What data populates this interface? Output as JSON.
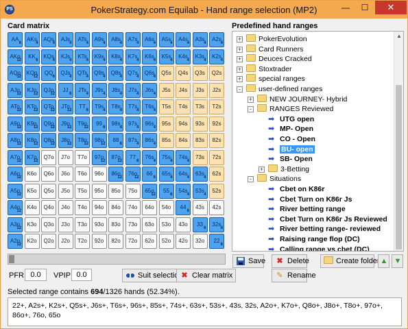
{
  "window": {
    "title": "PokerStrategy.com Equilab - Hand range selection (MP2)",
    "minimize": "—",
    "maximize": "☐",
    "close": "✕"
  },
  "card_matrix": {
    "label": "Card matrix",
    "ranks": [
      "A",
      "K",
      "Q",
      "J",
      "T",
      "9",
      "8",
      "7",
      "6",
      "5",
      "4",
      "3",
      "2"
    ],
    "cells": [
      [
        "AA",
        "AKs",
        "AQs",
        "AJs",
        "ATs",
        "A9s",
        "A8s",
        "A7s",
        "A6s",
        "A5s",
        "A4s",
        "A3s",
        "A2s"
      ],
      [
        "AKo",
        "KK",
        "KQs",
        "KJs",
        "KTs",
        "K9s",
        "K8s",
        "K7s",
        "K6s",
        "K5s",
        "K4s",
        "K3s",
        "K2s"
      ],
      [
        "AQo",
        "KQo",
        "QQ",
        "QJs",
        "QTs",
        "Q9s",
        "Q8s",
        "Q7s",
        "Q6s",
        "Q5s",
        "Q4s",
        "Q3s",
        "Q2s"
      ],
      [
        "AJo",
        "KJo",
        "QJo",
        "JJ",
        "JTs",
        "J9s",
        "J8s",
        "J7s",
        "J6s",
        "J5s",
        "J4s",
        "J3s",
        "J2s"
      ],
      [
        "ATo",
        "KTo",
        "QTo",
        "JTo",
        "TT",
        "T9s",
        "T8s",
        "T7s",
        "T6s",
        "T5s",
        "T4s",
        "T3s",
        "T2s"
      ],
      [
        "A9o",
        "K9o",
        "Q9o",
        "J9o",
        "T9o",
        "99",
        "98s",
        "97s",
        "96s",
        "95s",
        "94s",
        "93s",
        "92s"
      ],
      [
        "A8o",
        "K8o",
        "Q8o",
        "J8o",
        "T8o",
        "98o",
        "88",
        "87s",
        "86s",
        "85s",
        "84s",
        "83s",
        "82s"
      ],
      [
        "A7o",
        "K7o",
        "Q7o",
        "J7o",
        "T7o",
        "97o",
        "87o",
        "77",
        "76s",
        "75s",
        "74s",
        "73s",
        "72s"
      ],
      [
        "A6o",
        "K6o",
        "Q6o",
        "J6o",
        "T6o",
        "96o",
        "86o",
        "76o",
        "66",
        "65s",
        "64s",
        "63s",
        "62s"
      ],
      [
        "A5o",
        "K5o",
        "Q5o",
        "J5o",
        "T5o",
        "95o",
        "85o",
        "75o",
        "65o",
        "55",
        "54s",
        "53s",
        "52s"
      ],
      [
        "A4o",
        "K4o",
        "Q4o",
        "J4o",
        "T4o",
        "94o",
        "84o",
        "74o",
        "64o",
        "54o",
        "44",
        "43s",
        "42s"
      ],
      [
        "A3o",
        "K3o",
        "Q3o",
        "J3o",
        "T3o",
        "93o",
        "83o",
        "73o",
        "63o",
        "53o",
        "43o",
        "33",
        "32s"
      ],
      [
        "A2o",
        "K2o",
        "Q2o",
        "J2o",
        "T2o",
        "92o",
        "82o",
        "72o",
        "62o",
        "52o",
        "42o",
        "32o",
        "22"
      ]
    ],
    "state": [
      "SSSSSSSSSSSSS",
      "SSSSSSSSSSSSS",
      "SSSSSSSSSHHHH",
      "SSSSSSSSSHHHH",
      "SSSSSSSSSHHHH",
      "SSSSSSSSSHHHH",
      "SSSSSSSSSHHHH",
      "SSNNNSSSSSSHH",
      "SNNNNNSSSSSSH",
      "SNNNNNNNSSSSH",
      "SNNNNNNNNNSNN",
      "SNNNNNNNNNNSS",
      "SNNNNNNNNNNNS"
    ],
    "pair_count": "6",
    "suited_count": "4",
    "offsuit_count": "12"
  },
  "predefined": {
    "label": "Predefined hand ranges",
    "tree": [
      {
        "text": "PokerEvolution",
        "kind": "folder",
        "expander": "+",
        "level": 0,
        "bold": false
      },
      {
        "text": "Card Runners",
        "kind": "folder",
        "expander": "+",
        "level": 0,
        "bold": false
      },
      {
        "text": "Deuces Cracked",
        "kind": "folder",
        "expander": "+",
        "level": 0,
        "bold": false
      },
      {
        "text": "Stoxtrader",
        "kind": "folder",
        "expander": "+",
        "level": 0,
        "bold": false
      },
      {
        "text": "special ranges",
        "kind": "folder",
        "expander": "+",
        "level": 0,
        "bold": false
      },
      {
        "text": "user-defined ranges",
        "kind": "folder",
        "expander": "-",
        "level": 0,
        "bold": false
      },
      {
        "text": "NEW JOURNEY- Hybrid",
        "kind": "folder",
        "expander": "+",
        "level": 1,
        "bold": false
      },
      {
        "text": "RANGES Reviewed",
        "kind": "folder",
        "expander": "-",
        "level": 1,
        "bold": false
      },
      {
        "text": "UTG open",
        "kind": "range",
        "expander": "",
        "level": 2,
        "bold": true
      },
      {
        "text": "MP- Open",
        "kind": "range",
        "expander": "",
        "level": 2,
        "bold": true
      },
      {
        "text": "CO - Open",
        "kind": "range",
        "expander": "",
        "level": 2,
        "bold": true
      },
      {
        "text": "BU- open",
        "kind": "range",
        "expander": "",
        "level": 2,
        "bold": true,
        "selected": true
      },
      {
        "text": "SB- Open",
        "kind": "range",
        "expander": "",
        "level": 2,
        "bold": true
      },
      {
        "text": "3-Betting",
        "kind": "folder",
        "expander": "+",
        "level": 2,
        "bold": false
      },
      {
        "text": "Situations",
        "kind": "folder",
        "expander": "-",
        "level": 1,
        "bold": false
      },
      {
        "text": "Cbet on K86r",
        "kind": "range",
        "expander": "",
        "level": 2,
        "bold": true
      },
      {
        "text": "Cbet Turn on K86r Js",
        "kind": "range",
        "expander": "",
        "level": 2,
        "bold": true
      },
      {
        "text": "River betting range",
        "kind": "range",
        "expander": "",
        "level": 2,
        "bold": true
      },
      {
        "text": "Cbet Turn on K86r Js Reviewed",
        "kind": "range",
        "expander": "",
        "level": 2,
        "bold": true
      },
      {
        "text": "River betting range- reviewed",
        "kind": "range",
        "expander": "",
        "level": 2,
        "bold": true
      },
      {
        "text": "Raising range flop (DC)",
        "kind": "range",
        "expander": "",
        "level": 2,
        "bold": true
      },
      {
        "text": "Calling range vs cbet (DC)",
        "kind": "range",
        "expander": "",
        "level": 2,
        "bold": true
      }
    ],
    "save_label": "Save",
    "delete_label": "Delete",
    "create_folder_label": "Create folder",
    "rename_label": "Rename"
  },
  "controls": {
    "pfr_label": "PFR:",
    "pfr_value": "0.0",
    "vpip_label": "VPIP:",
    "vpip_value": "0.0",
    "suit_selection_label": "Suit selection",
    "clear_matrix_label": "Clear matrix",
    "slider_level": 0
  },
  "status": {
    "prefix": "Selected range contains ",
    "hands": "694",
    "suffix": "/1326 hands (52.34%)."
  },
  "range_text": "22+, A2s+, K2s+, Q5s+, J6s+, T6s+, 96s+, 85s+, 74s+, 63s+, 53s+, 43s, 32s, A2o+, K7o+, Q8o+, J8o+, T8o+, 97o+, 86o+, 76o, 65o",
  "colors": {
    "selected": "#4da3f0",
    "highlighted": "#fbe2b0",
    "unselected": "#fafafa",
    "titlebar": "#f4a94e"
  }
}
